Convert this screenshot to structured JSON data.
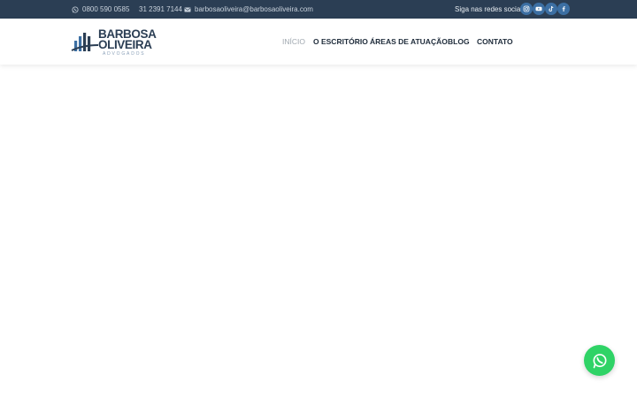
{
  "topbar": {
    "phone1": "0800 590 0585",
    "phone2": "31 2391 7144",
    "email": "barbosaoliveira@barbosaoliveira.com",
    "follow_label": "Siga nas redes sociais",
    "icons": {
      "phone1": "whatsapp-icon",
      "phone2": "phone-icon",
      "email": "envelope-icon"
    },
    "socials": [
      "instagram-icon",
      "youtube-icon",
      "tiktok-icon",
      "facebook-icon"
    ],
    "colors": {
      "background": "#2b3e54",
      "social_circle": "#3c6fa3"
    }
  },
  "header": {
    "logo": {
      "line1": "BARBOSA",
      "line2": "OLIVEIRA",
      "line3": "ADVOGADOS"
    },
    "nav": [
      {
        "label": "INÍCIO",
        "active": true
      },
      {
        "label": "O ESCRITÓRIO",
        "active": false
      },
      {
        "label": "ÁREAS DE ATUAÇÃO",
        "active": false
      },
      {
        "label": "BLOG",
        "active": false
      },
      {
        "label": "CONTATO",
        "active": false
      }
    ]
  },
  "floating": {
    "icon": "whatsapp-icon",
    "color": "#2fd366"
  }
}
